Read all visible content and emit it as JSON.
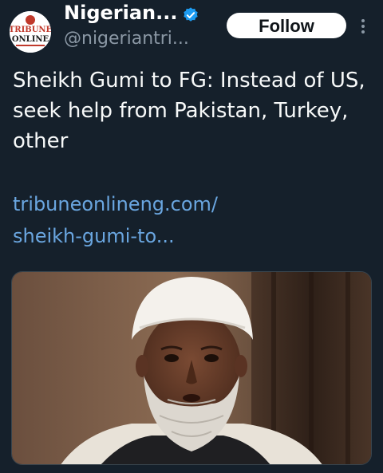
{
  "account": {
    "display_name": "Nigerian...",
    "handle": "@nigeriantri...",
    "avatar_text_top": "TRIBUNE",
    "avatar_text_bottom": "ONLINE",
    "verified_color": "#1d9bf0"
  },
  "actions": {
    "follow_label": "Follow"
  },
  "tweet": {
    "text": "Sheikh Gumi to FG: Instead of US, seek help from Pakistan, Turkey, other",
    "link_line1": "tribuneonlineng.com/",
    "link_line2": "sheikh-gumi-to..."
  },
  "colors": {
    "background": "#15202b",
    "link": "#6aa6e0",
    "secondary_text": "#8b98a5"
  },
  "icons": {
    "more": "more-vertical-icon",
    "verified": "verified-badge-icon"
  }
}
